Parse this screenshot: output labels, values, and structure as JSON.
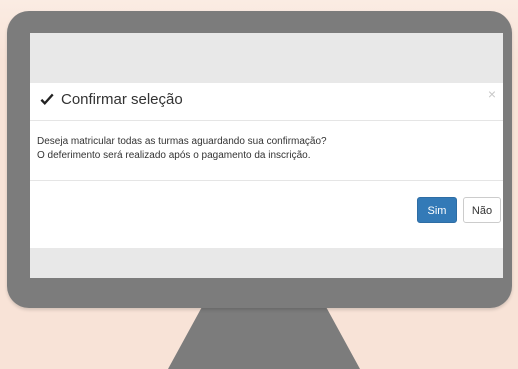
{
  "dialog": {
    "title": "Confirmar seleção",
    "close_symbol": "×",
    "body_lines": [
      "Deseja matricular todas as turmas aguardando sua confirmação?",
      "O deferimento será realizado após o pagamento da inscrição."
    ],
    "confirm_label": "Sim",
    "cancel_label": "Não"
  },
  "icons": {
    "title_icon": "check-icon",
    "close_icon": "close-icon"
  },
  "colors": {
    "background": "#f8e3d7",
    "monitor": "#7c7c7c",
    "screen_backdrop": "#e8e8e8",
    "primary_button": "#337ab7"
  }
}
